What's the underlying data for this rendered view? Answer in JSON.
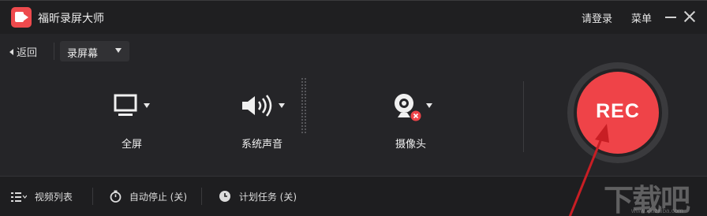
{
  "titlebar": {
    "app_title": "福昕录屏大师",
    "login_label": "请登录",
    "menu_label": "菜单"
  },
  "toolbar": {
    "back_label": "返回",
    "mode_label": "录屏幕"
  },
  "options": {
    "screen_label": "全屏",
    "audio_label": "系统声音",
    "camera_label": "摄像头"
  },
  "rec": {
    "label": "REC",
    "color": "#ef4348"
  },
  "bottombar": {
    "video_list_label": "视频列表",
    "auto_stop_label": "自动停止 (关)",
    "schedule_label": "计划任务 (关)"
  },
  "watermark": {
    "text": "下载吧",
    "sub": "www.xiazaiba.com"
  },
  "colors": {
    "accent": "#ef4348",
    "arrow": "#c81e24",
    "background": "#252528"
  }
}
